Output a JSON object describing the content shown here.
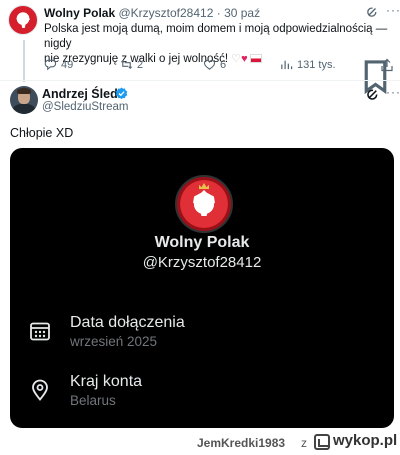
{
  "quoted_tweet": {
    "author_name": "Wolny Polak",
    "handle": "@Krzysztof28412",
    "separator": "·",
    "date": "30 paź",
    "text_line1": "Polska jest moją dumą, moim domem i moją odpowiedzialnością — nigdy",
    "text_line2": "nie zrezygnuję z walki o jej wolność!",
    "actions": {
      "replies": "49",
      "reposts": "2",
      "likes": "6",
      "views": "131 tys."
    },
    "icons": [
      "grok-icon",
      "more-icon",
      "reply-icon",
      "repost-icon",
      "like-icon",
      "views-icon",
      "bookmark-icon",
      "share-icon"
    ]
  },
  "main_tweet": {
    "author_name": "Andrzej Śledź",
    "handle": "@SledziuStream",
    "text": "Chłopie XD",
    "icons": [
      "verified-badge-icon",
      "grok-icon",
      "more-icon"
    ]
  },
  "profile_card": {
    "name": "Wolny Polak",
    "handle": "@Krzysztof28412",
    "joined_label": "Data dołączenia",
    "joined_value": "wrzesień 2025",
    "country_label": "Kraj konta",
    "country_value": "Belarus",
    "icons": [
      "calendar-icon",
      "location-pin-icon"
    ]
  },
  "watermark": {
    "username": "JemKredki1983",
    "connector": "z",
    "site": "wykop.pl"
  },
  "colors": {
    "text": "#0f1419",
    "muted": "#536471",
    "verified": "#1d9bf0",
    "card_bg": "#000000",
    "card_text": "#e7e9ea",
    "card_muted": "#71767b",
    "poland_red": "#dc143c",
    "heart_red": "#e0245e"
  }
}
